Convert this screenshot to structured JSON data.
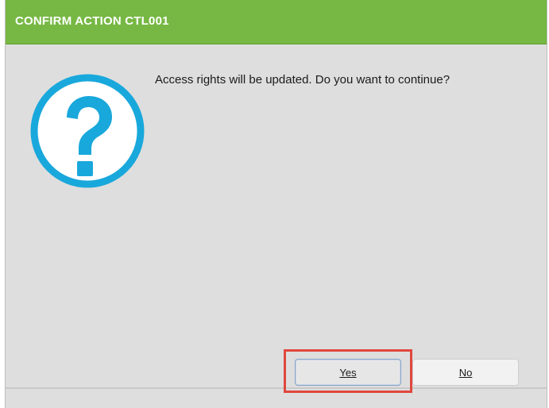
{
  "dialog": {
    "title": "CONFIRM ACTION CTL001",
    "message": "Access rights will be updated. Do you want to continue?",
    "icon": "question-icon"
  },
  "buttons": {
    "yes_label": "Yes",
    "no_label": "No"
  },
  "colors": {
    "titlebar": "#76b843",
    "icon": "#19a8dc",
    "highlight": "#e0473d"
  }
}
